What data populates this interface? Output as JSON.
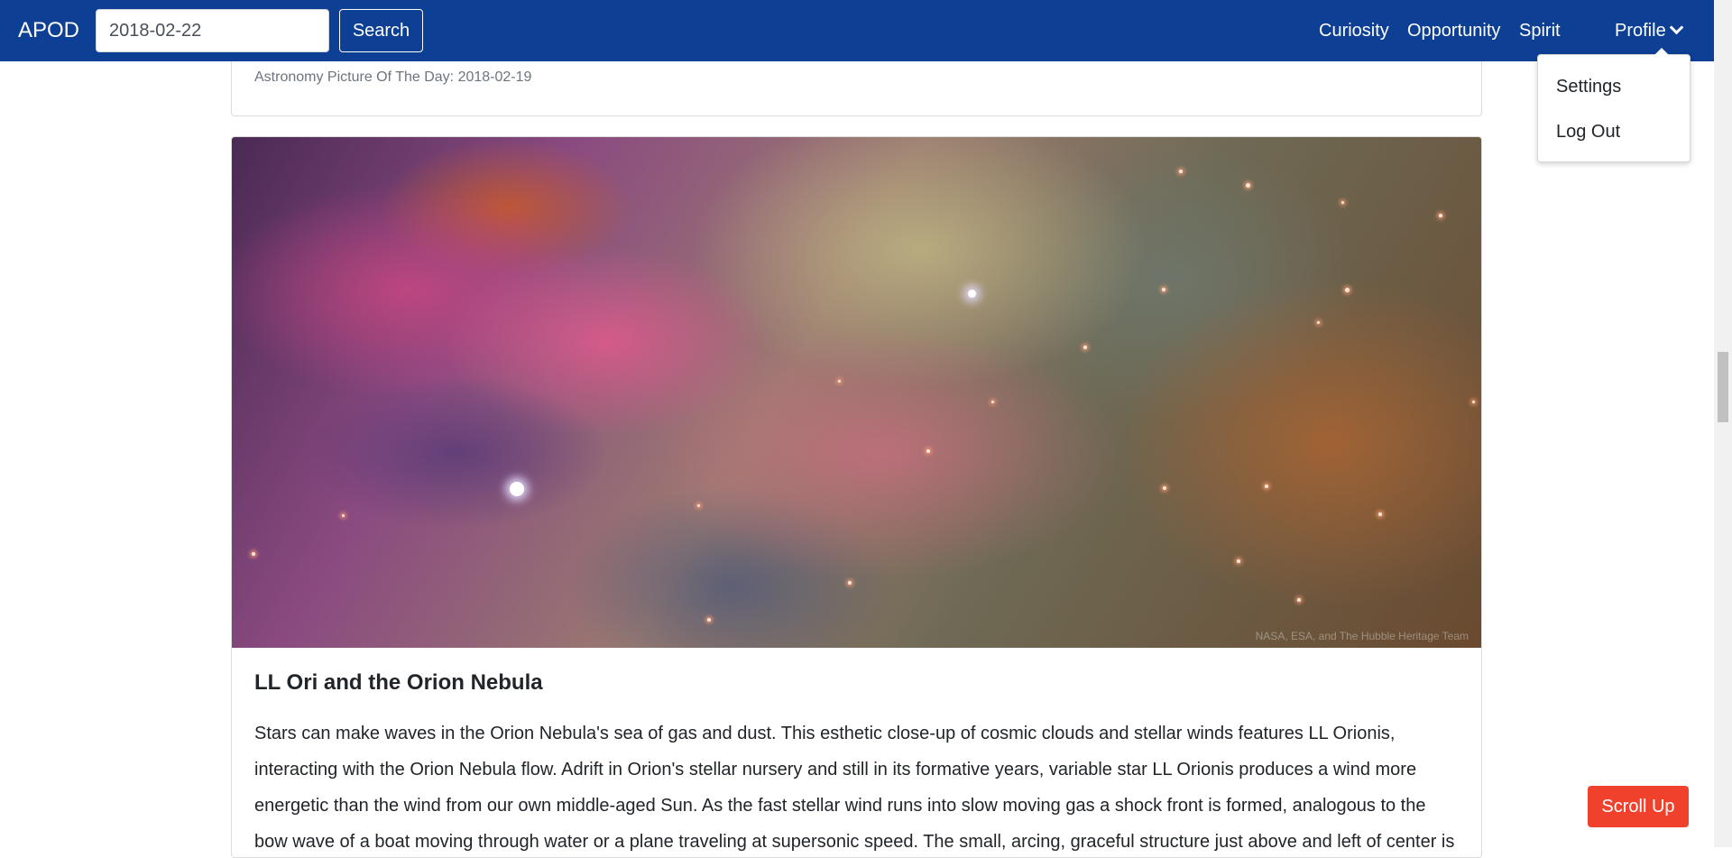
{
  "navbar": {
    "brand": "APOD",
    "search_value": "2018-02-22",
    "search_button": "Search",
    "links": [
      "Curiosity",
      "Opportunity",
      "Spirit"
    ],
    "profile_label": "Profile",
    "background_color": "#0d3f94"
  },
  "profile_menu": {
    "items": [
      "Settings",
      "Log Out"
    ]
  },
  "previous_card": {
    "caption": "Astronomy Picture Of The Day: 2018-02-19"
  },
  "apod_card": {
    "image_icon": "nebula-image",
    "image_credit": "NASA, ESA, and The Hubble Heritage Team",
    "title": "LL Ori and the Orion Nebula",
    "explanation": "Stars can make waves in the Orion Nebula's sea of gas and dust. This esthetic close-up of cosmic clouds and stellar winds features LL Orionis, interacting with the Orion Nebula flow. Adrift in Orion's stellar nursery and still in its formative years, variable star LL Orionis produces a wind more energetic than the wind from our own middle-aged Sun. As the fast stellar wind runs into slow moving gas a shock front is formed, analogous to the bow wave of a boat moving through water or a plane traveling at supersonic speed. The small, arcing, graceful structure just above and left of center is"
  },
  "scroll_up_button": {
    "label": "Scroll Up",
    "color": "#f0412d"
  }
}
